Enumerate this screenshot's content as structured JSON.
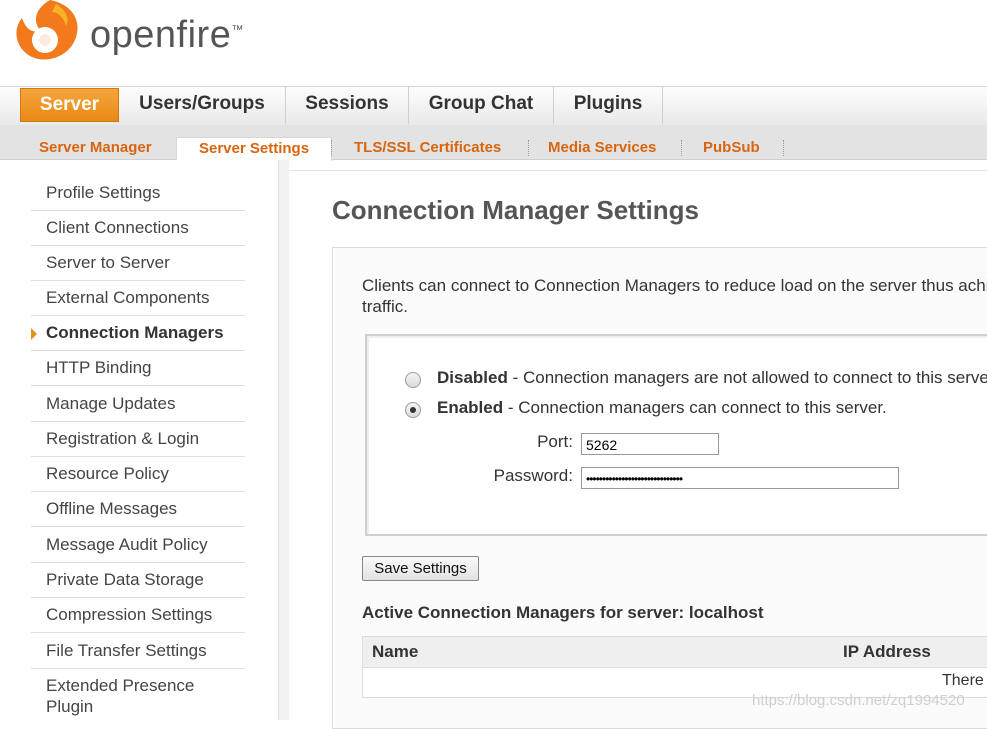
{
  "brand": {
    "name": "openfire",
    "trademark": "™"
  },
  "main_tabs": [
    {
      "label": "Server",
      "active": true
    },
    {
      "label": "Users/Groups",
      "active": false
    },
    {
      "label": "Sessions",
      "active": false
    },
    {
      "label": "Group Chat",
      "active": false
    },
    {
      "label": "Plugins",
      "active": false
    }
  ],
  "sub_tabs": [
    {
      "label": "Server Manager",
      "active": false
    },
    {
      "label": "Server Settings",
      "active": true
    },
    {
      "label": "TLS/SSL Certificates",
      "active": false
    },
    {
      "label": "Media Services",
      "active": false
    },
    {
      "label": "PubSub",
      "active": false
    }
  ],
  "sidebar": {
    "items": [
      {
        "label": "Profile Settings"
      },
      {
        "label": "Client Connections"
      },
      {
        "label": "Server to Server"
      },
      {
        "label": "External Components"
      },
      {
        "label": "Connection Managers",
        "active": true
      },
      {
        "label": "HTTP Binding"
      },
      {
        "label": "Manage Updates"
      },
      {
        "label": "Registration & Login"
      },
      {
        "label": "Resource Policy"
      },
      {
        "label": "Offline Messages"
      },
      {
        "label": "Message Audit Policy"
      },
      {
        "label": "Private Data Storage"
      },
      {
        "label": "Compression Settings"
      },
      {
        "label": "File Transfer Settings"
      },
      {
        "label": "Extended Presence",
        "label2": "Plugin"
      }
    ]
  },
  "page": {
    "title": "Connection Manager Settings",
    "description_line1": "Clients can connect to Connection Managers to reduce load on the server thus achieving",
    "description_line2": "traffic."
  },
  "options": {
    "disabled": {
      "title": "Disabled",
      "text": " - Connection managers are not allowed to connect to this server.",
      "selected": false
    },
    "enabled": {
      "title": "Enabled",
      "text": " - Connection managers can connect to this server.",
      "selected": true
    },
    "port_label": "Port:",
    "port_value": "5262",
    "password_label": "Password:",
    "password_value": "••••••••••••••••••••••••••••••"
  },
  "save_button": "Save Settings",
  "active_managers": {
    "heading": "Active Connection Managers for server: localhost",
    "columns": [
      "Name",
      "IP Address"
    ],
    "empty_text": "There are no"
  },
  "watermark": "https://blog.csdn.net/zq1994520",
  "colors": {
    "accent": "#e98a16",
    "subtab_text": "#d8650f"
  }
}
